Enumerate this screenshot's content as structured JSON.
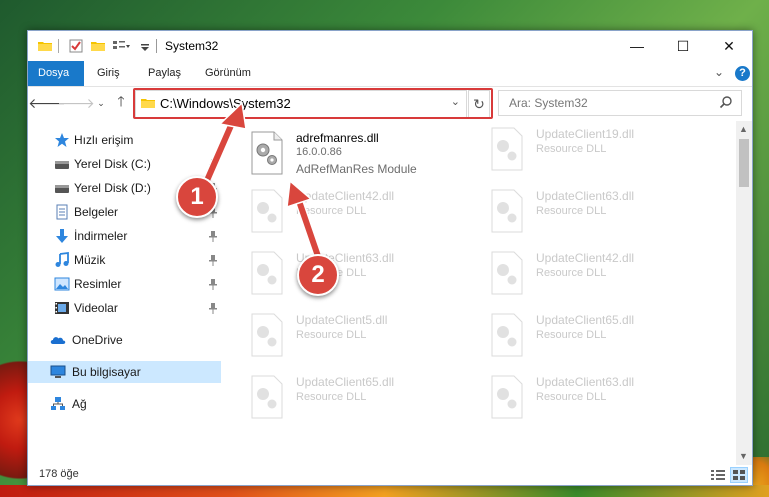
{
  "window": {
    "title": "System32",
    "controls": {
      "minimize": "—",
      "maximize": "☐",
      "close": "✕"
    }
  },
  "ribbon": {
    "tabs": [
      {
        "label": "Dosya",
        "active": true
      },
      {
        "label": "Giriş"
      },
      {
        "label": "Paylaş"
      },
      {
        "label": "Görünüm"
      }
    ],
    "expand": "⌄",
    "help": "?"
  },
  "address": {
    "path": "C:\\Windows\\System32",
    "dropdown": "⌄",
    "refresh": "↻"
  },
  "search": {
    "placeholder": "Ara: System32"
  },
  "nav_pane": {
    "items": [
      {
        "label": "Hızlı erişim",
        "icon": "star-icon"
      },
      {
        "label": "Yerel Disk (C:)",
        "icon": "drive-icon",
        "pinned": true
      },
      {
        "label": "Yerel Disk (D:)",
        "icon": "drive-icon",
        "pinned": true
      },
      {
        "label": "Belgeler",
        "icon": "document-icon",
        "pinned": true
      },
      {
        "label": "İndirmeler",
        "icon": "download-icon",
        "pinned": true
      },
      {
        "label": "Müzik",
        "icon": "music-icon",
        "pinned": true
      },
      {
        "label": "Resimler",
        "icon": "picture-icon",
        "pinned": true
      },
      {
        "label": "Videolar",
        "icon": "video-icon",
        "pinned": true
      },
      {
        "label": "OneDrive",
        "icon": "cloud-icon"
      },
      {
        "label": "Bu bilgisayar",
        "icon": "computer-icon",
        "selected": true
      },
      {
        "label": "Ağ",
        "icon": "network-icon"
      }
    ]
  },
  "files": {
    "highlighted": {
      "name": "adrefmanres.dll",
      "version": "16.0.0.86",
      "description": "AdRefManRes Module"
    },
    "left": [
      {
        "name": "UpdateClient42.dll",
        "type": "Resource DLL"
      },
      {
        "name": "UpdateClient63.dll",
        "type": "Resource DLL"
      },
      {
        "name": "UpdateClient5.dll",
        "type": "Resource DLL"
      },
      {
        "name": "UpdateClient65.dll",
        "type": "Resource DLL"
      }
    ],
    "right": [
      {
        "name": "UpdateClient19.dll",
        "type": "Resource DLL"
      },
      {
        "name": "UpdateClient63.dll",
        "type": "Resource DLL"
      },
      {
        "name": "UpdateClient42.dll",
        "type": "Resource DLL"
      },
      {
        "name": "UpdateClient65.dll",
        "type": "Resource DLL"
      },
      {
        "name": "UpdateClient63.dll",
        "type": "Resource DLL"
      }
    ]
  },
  "status": {
    "count": "178 öğe"
  },
  "annotations": {
    "marker1": "1",
    "marker2": "2"
  },
  "colors": {
    "accent": "#1979ca",
    "highlight": "#d83a3a",
    "marker": "#d9463d",
    "selected": "#cce8ff"
  }
}
